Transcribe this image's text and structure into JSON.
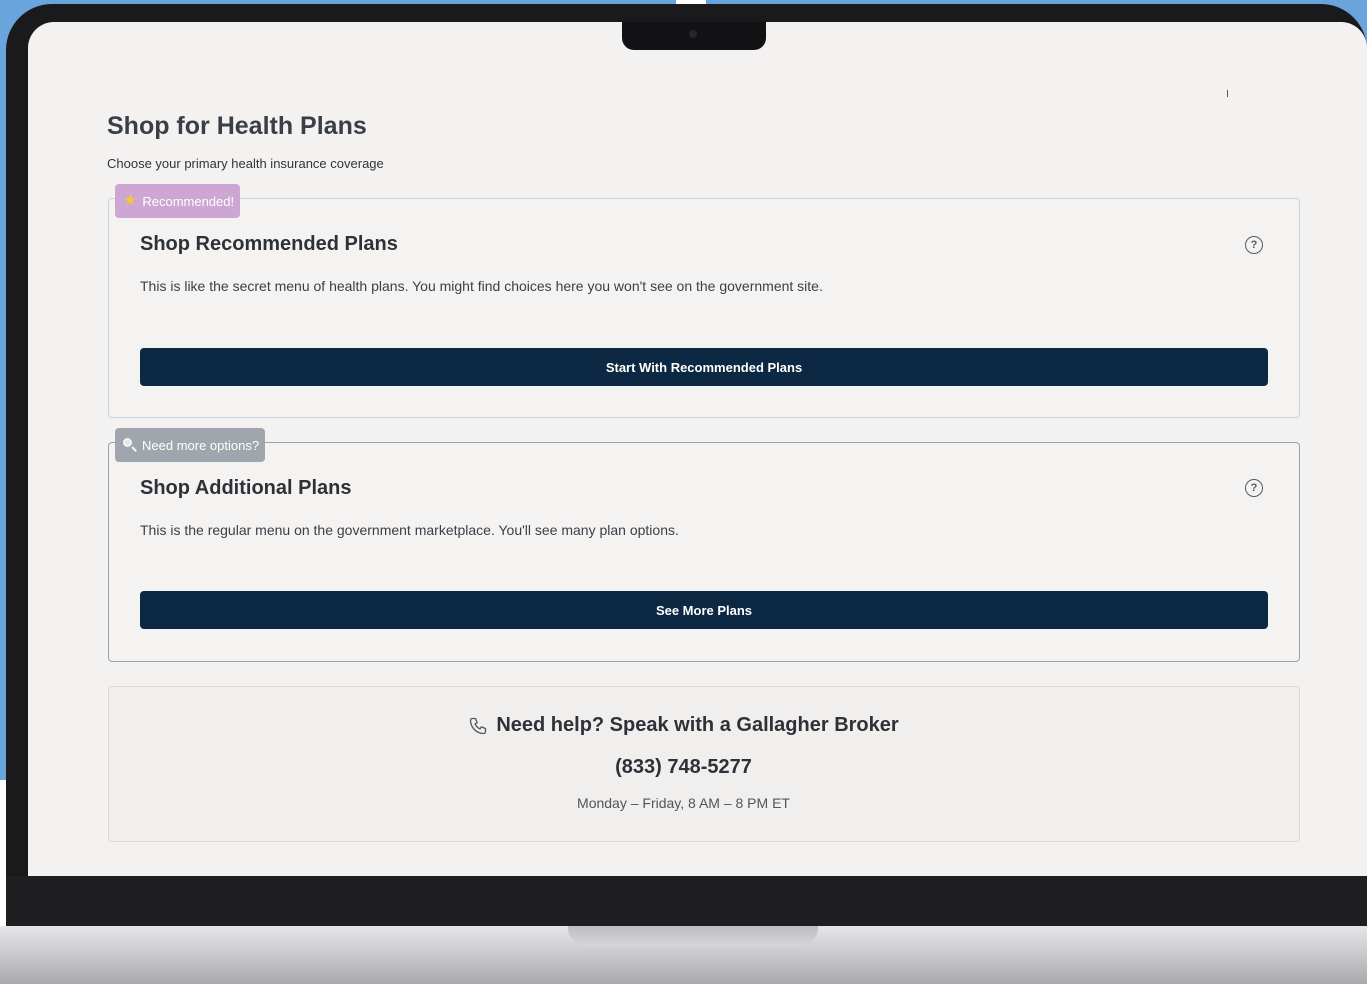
{
  "page": {
    "title": "Shop for Health Plans",
    "subtitle": "Choose your primary health insurance coverage"
  },
  "recommended": {
    "tag_label": "Recommended!",
    "tag_icon": "star-icon",
    "title": "Shop Recommended Plans",
    "description": "This is like the secret menu of health plans. You might find choices here you won't see on the government site.",
    "button_label": "Start With Recommended Plans",
    "help_icon": "question-circle-icon"
  },
  "additional": {
    "tag_label": "Need more options?",
    "tag_icon": "magnifier-icon",
    "title": "Shop Additional Plans",
    "description": "This is the regular menu on the government marketplace. You'll see many plan options.",
    "button_label": "See More Plans",
    "help_icon": "question-circle-icon"
  },
  "help": {
    "icon": "phone-icon",
    "heading": "Need help? Speak with a Gallagher Broker",
    "phone": "(833) 748-5277",
    "hours": "Monday – Friday, 8 AM – 8 PM ET"
  },
  "colors": {
    "button_bg": "#0c2842",
    "recommended_tag": "#cda6d3",
    "additional_tag": "#a0a6ad",
    "background": "#6aa4dc"
  }
}
